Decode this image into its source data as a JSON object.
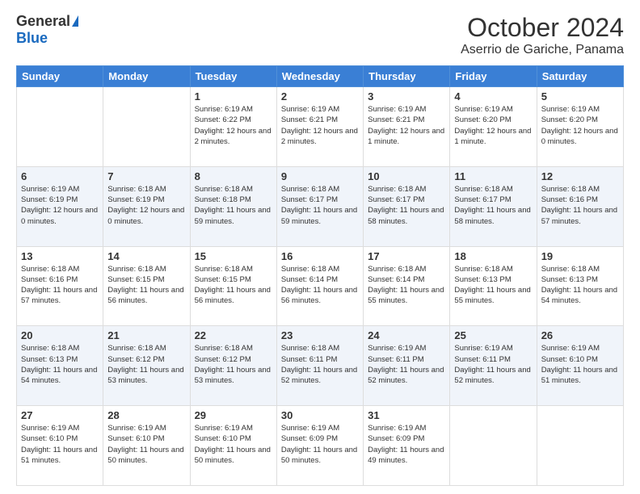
{
  "logo": {
    "general": "General",
    "blue": "Blue"
  },
  "title": "October 2024",
  "location": "Aserrio de Gariche, Panama",
  "days_header": [
    "Sunday",
    "Monday",
    "Tuesday",
    "Wednesday",
    "Thursday",
    "Friday",
    "Saturday"
  ],
  "weeks": [
    {
      "shaded": false,
      "days": [
        {
          "num": "",
          "info": ""
        },
        {
          "num": "",
          "info": ""
        },
        {
          "num": "1",
          "info": "Sunrise: 6:19 AM\nSunset: 6:22 PM\nDaylight: 12 hours and 2 minutes."
        },
        {
          "num": "2",
          "info": "Sunrise: 6:19 AM\nSunset: 6:21 PM\nDaylight: 12 hours and 2 minutes."
        },
        {
          "num": "3",
          "info": "Sunrise: 6:19 AM\nSunset: 6:21 PM\nDaylight: 12 hours and 1 minute."
        },
        {
          "num": "4",
          "info": "Sunrise: 6:19 AM\nSunset: 6:20 PM\nDaylight: 12 hours and 1 minute."
        },
        {
          "num": "5",
          "info": "Sunrise: 6:19 AM\nSunset: 6:20 PM\nDaylight: 12 hours and 0 minutes."
        }
      ]
    },
    {
      "shaded": true,
      "days": [
        {
          "num": "6",
          "info": "Sunrise: 6:19 AM\nSunset: 6:19 PM\nDaylight: 12 hours and 0 minutes."
        },
        {
          "num": "7",
          "info": "Sunrise: 6:18 AM\nSunset: 6:19 PM\nDaylight: 12 hours and 0 minutes."
        },
        {
          "num": "8",
          "info": "Sunrise: 6:18 AM\nSunset: 6:18 PM\nDaylight: 11 hours and 59 minutes."
        },
        {
          "num": "9",
          "info": "Sunrise: 6:18 AM\nSunset: 6:17 PM\nDaylight: 11 hours and 59 minutes."
        },
        {
          "num": "10",
          "info": "Sunrise: 6:18 AM\nSunset: 6:17 PM\nDaylight: 11 hours and 58 minutes."
        },
        {
          "num": "11",
          "info": "Sunrise: 6:18 AM\nSunset: 6:17 PM\nDaylight: 11 hours and 58 minutes."
        },
        {
          "num": "12",
          "info": "Sunrise: 6:18 AM\nSunset: 6:16 PM\nDaylight: 11 hours and 57 minutes."
        }
      ]
    },
    {
      "shaded": false,
      "days": [
        {
          "num": "13",
          "info": "Sunrise: 6:18 AM\nSunset: 6:16 PM\nDaylight: 11 hours and 57 minutes."
        },
        {
          "num": "14",
          "info": "Sunrise: 6:18 AM\nSunset: 6:15 PM\nDaylight: 11 hours and 56 minutes."
        },
        {
          "num": "15",
          "info": "Sunrise: 6:18 AM\nSunset: 6:15 PM\nDaylight: 11 hours and 56 minutes."
        },
        {
          "num": "16",
          "info": "Sunrise: 6:18 AM\nSunset: 6:14 PM\nDaylight: 11 hours and 56 minutes."
        },
        {
          "num": "17",
          "info": "Sunrise: 6:18 AM\nSunset: 6:14 PM\nDaylight: 11 hours and 55 minutes."
        },
        {
          "num": "18",
          "info": "Sunrise: 6:18 AM\nSunset: 6:13 PM\nDaylight: 11 hours and 55 minutes."
        },
        {
          "num": "19",
          "info": "Sunrise: 6:18 AM\nSunset: 6:13 PM\nDaylight: 11 hours and 54 minutes."
        }
      ]
    },
    {
      "shaded": true,
      "days": [
        {
          "num": "20",
          "info": "Sunrise: 6:18 AM\nSunset: 6:13 PM\nDaylight: 11 hours and 54 minutes."
        },
        {
          "num": "21",
          "info": "Sunrise: 6:18 AM\nSunset: 6:12 PM\nDaylight: 11 hours and 53 minutes."
        },
        {
          "num": "22",
          "info": "Sunrise: 6:18 AM\nSunset: 6:12 PM\nDaylight: 11 hours and 53 minutes."
        },
        {
          "num": "23",
          "info": "Sunrise: 6:18 AM\nSunset: 6:11 PM\nDaylight: 11 hours and 52 minutes."
        },
        {
          "num": "24",
          "info": "Sunrise: 6:19 AM\nSunset: 6:11 PM\nDaylight: 11 hours and 52 minutes."
        },
        {
          "num": "25",
          "info": "Sunrise: 6:19 AM\nSunset: 6:11 PM\nDaylight: 11 hours and 52 minutes."
        },
        {
          "num": "26",
          "info": "Sunrise: 6:19 AM\nSunset: 6:10 PM\nDaylight: 11 hours and 51 minutes."
        }
      ]
    },
    {
      "shaded": false,
      "days": [
        {
          "num": "27",
          "info": "Sunrise: 6:19 AM\nSunset: 6:10 PM\nDaylight: 11 hours and 51 minutes."
        },
        {
          "num": "28",
          "info": "Sunrise: 6:19 AM\nSunset: 6:10 PM\nDaylight: 11 hours and 50 minutes."
        },
        {
          "num": "29",
          "info": "Sunrise: 6:19 AM\nSunset: 6:10 PM\nDaylight: 11 hours and 50 minutes."
        },
        {
          "num": "30",
          "info": "Sunrise: 6:19 AM\nSunset: 6:09 PM\nDaylight: 11 hours and 50 minutes."
        },
        {
          "num": "31",
          "info": "Sunrise: 6:19 AM\nSunset: 6:09 PM\nDaylight: 11 hours and 49 minutes."
        },
        {
          "num": "",
          "info": ""
        },
        {
          "num": "",
          "info": ""
        }
      ]
    }
  ]
}
